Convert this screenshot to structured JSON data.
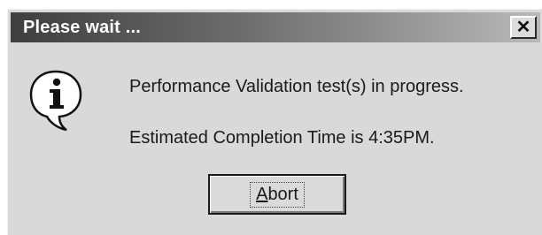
{
  "dialog": {
    "title": "Please wait ...",
    "close_symbol": "✕",
    "icon": "information-icon",
    "message_line1": "Performance Validation test(s) in progress.",
    "message_line2": "Estimated Completion Time is 4:35PM.",
    "abort_button": {
      "mnemonic": "A",
      "label_rest": "bort"
    }
  }
}
